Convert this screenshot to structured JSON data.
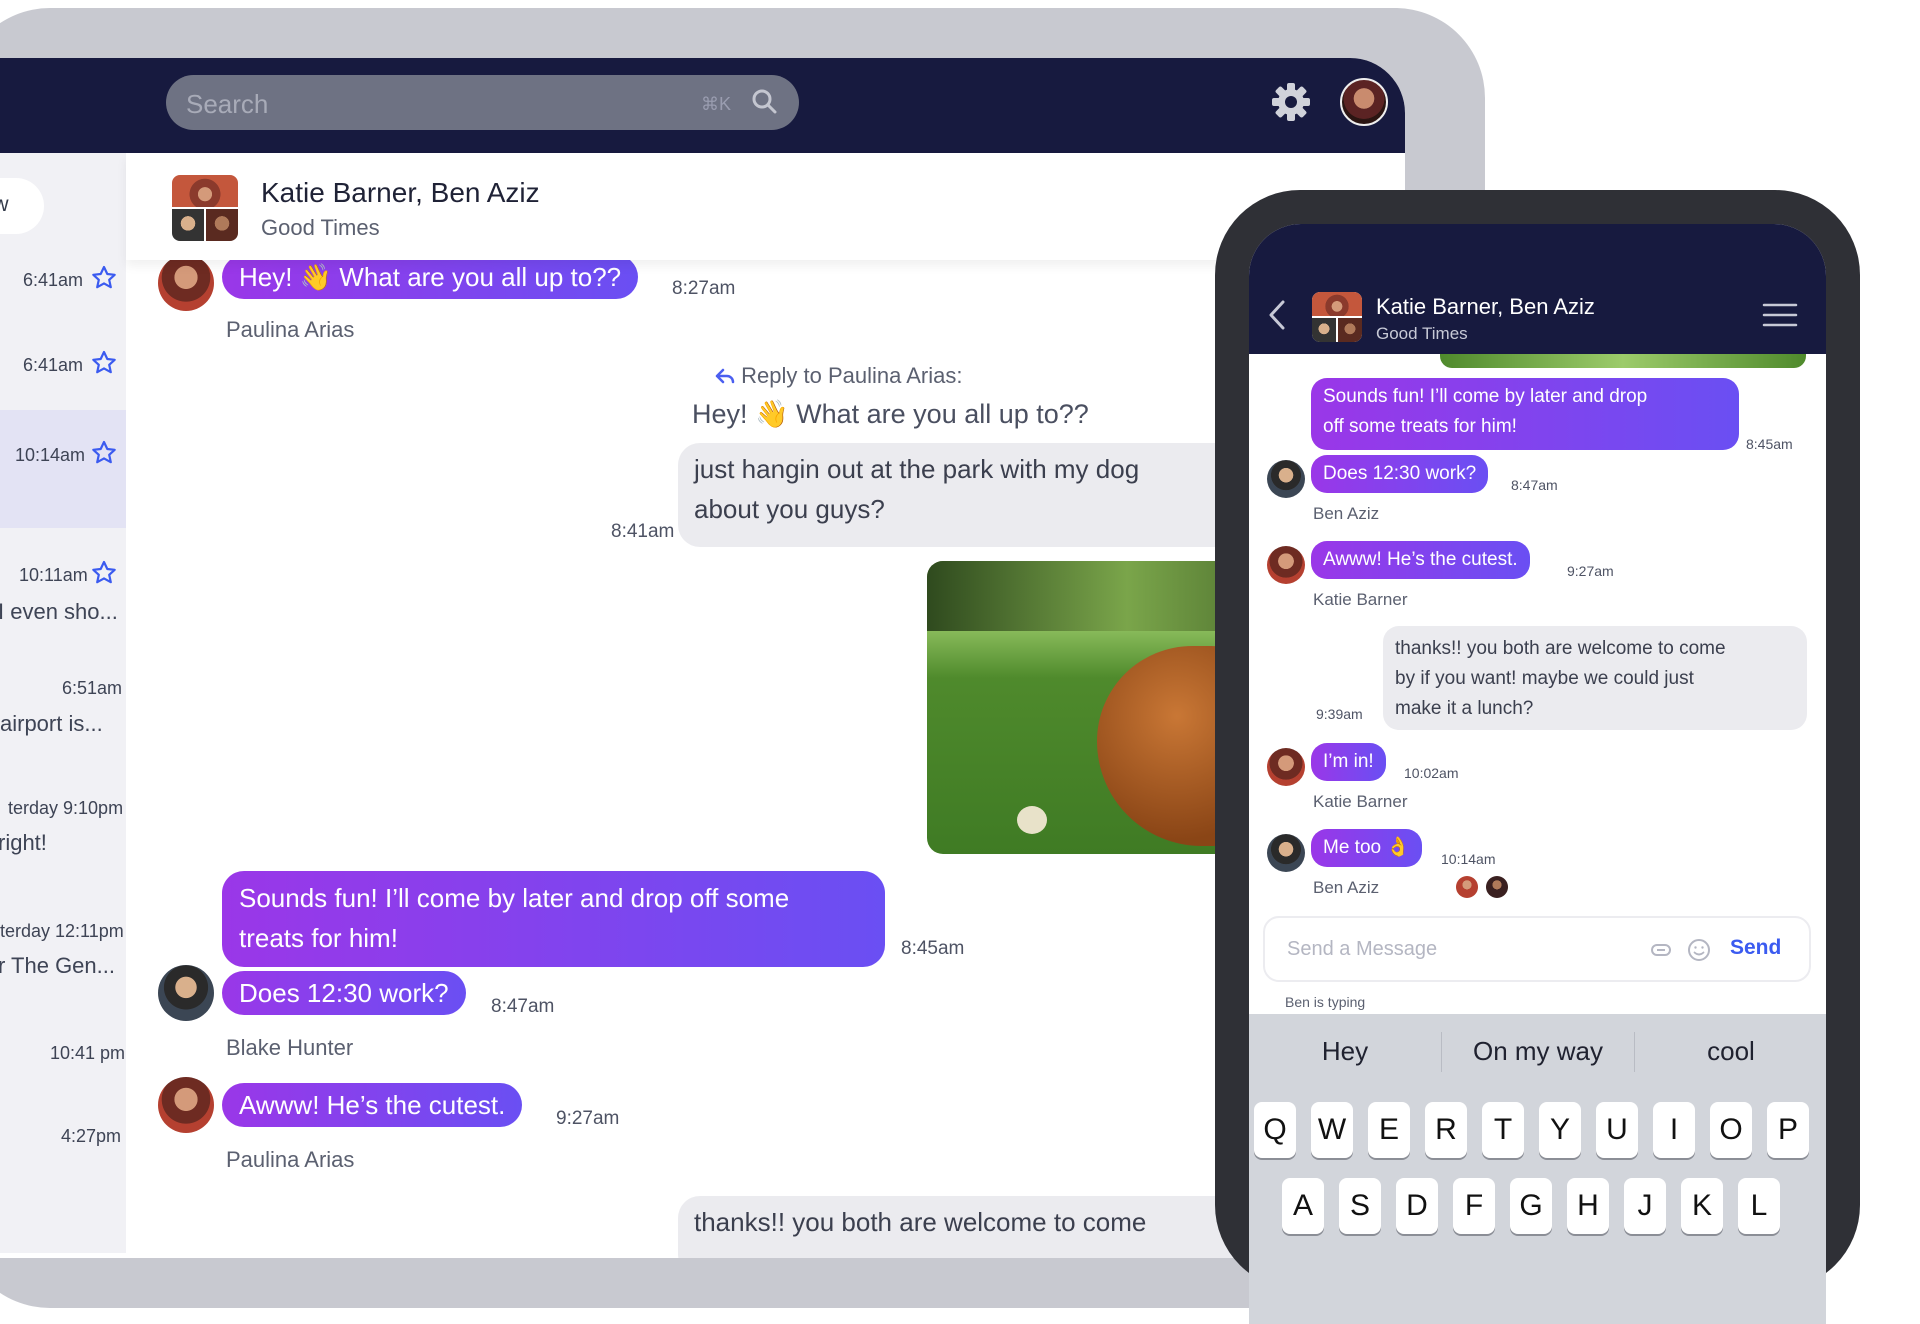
{
  "desktop": {
    "search": {
      "placeholder": "Search",
      "shortcut": "⌘K"
    },
    "sidebar": {
      "filter_pill": "Low",
      "items": [
        {
          "time": "6:41am",
          "starred": true
        },
        {
          "time": "6:41am",
          "starred": true
        },
        {
          "time": "10:14am",
          "starred": true,
          "selected": true
        },
        {
          "time": "10:11am",
          "starred": true,
          "snippet": "I even sho..."
        },
        {
          "time": "6:51am",
          "snippet": "airport is..."
        },
        {
          "time": "terday 9:10pm",
          "snippet": "right!"
        },
        {
          "time": "terday 12:11pm",
          "snippet": "r The Gen..."
        },
        {
          "time": "10:41 pm"
        },
        {
          "time": "4:27pm"
        }
      ]
    },
    "thread": {
      "title": "Katie Barner, Ben Aziz",
      "subtitle": "Good Times",
      "messages": [
        {
          "text": "Hey! 👋 What are you all up to??",
          "time": "8:27am",
          "sender": "Paulina Arias"
        },
        {
          "reply_label": "Reply to Paulina Arias:",
          "reply_text": "Hey! 👋 What are you all up to??",
          "line1": "just hangin out at the park with my dog",
          "line2": "about you guys?",
          "time": "8:41am"
        },
        {
          "line1": "Sounds fun! I’ll come by later and drop off some",
          "line2": "treats for him!",
          "time": "8:45am"
        },
        {
          "text": "Does 12:30 work?",
          "time": "8:47am",
          "sender": "Blake Hunter"
        },
        {
          "text": "Awww! He’s the cutest.",
          "time": "9:27am",
          "sender": "Paulina Arias"
        },
        {
          "text": "thanks!! you both are welcome to come"
        }
      ]
    }
  },
  "mobile": {
    "title": "Katie Barner, Ben Aziz",
    "subtitle": "Good Times",
    "messages": [
      {
        "line1": "Sounds fun! I’ll come by later and drop",
        "line2": "off some treats for him!",
        "time": "8:45am"
      },
      {
        "text": "Does 12:30 work?",
        "time": "8:47am",
        "sender": "Ben Aziz"
      },
      {
        "text": "Awww! He’s the cutest.",
        "time": "9:27am",
        "sender": "Katie Barner"
      },
      {
        "line1": "thanks!! you both are welcome to come",
        "line2": "by if you want! maybe we could just",
        "line3": "make it a lunch?",
        "time": "9:39am"
      },
      {
        "text": "I’m in!",
        "time": "10:02am",
        "sender": "Katie Barner"
      },
      {
        "text": "Me too 👌",
        "time": "10:14am",
        "sender": "Ben Aziz"
      }
    ],
    "input": {
      "placeholder": "Send a Message",
      "send_label": "Send"
    },
    "typing": "Ben is typing",
    "keyboard": {
      "suggestions": [
        "Hey",
        "On my way",
        "cool"
      ],
      "row1": [
        "Q",
        "W",
        "E",
        "R",
        "T",
        "Y",
        "U",
        "I",
        "O",
        "P"
      ],
      "row2": [
        "A",
        "S",
        "D",
        "F",
        "G",
        "H",
        "J",
        "K",
        "L"
      ]
    }
  },
  "colors": {
    "navy": "#171a3f",
    "bubble_start": "#9a37e8",
    "bubble_end": "#6a4ff3",
    "star": "#3b5bf0",
    "gray_bubble": "#ebebef"
  }
}
